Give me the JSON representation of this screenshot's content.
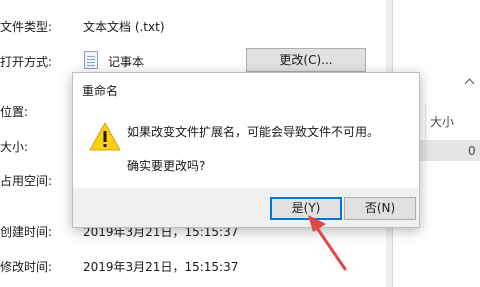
{
  "properties": {
    "type_label": "文件类型:",
    "type_value": "文本文档 (.txt)",
    "open_with_label": "打开方式:",
    "open_with_value": "记事本",
    "change_button": "更改(C)...",
    "location_label": "位置:",
    "size_label": "大小:",
    "size_on_disk_label": "占用空间:",
    "created_label": "创建时间:",
    "created_value": "2019年3月21日，15:15:37",
    "modified_label": "修改时间:",
    "modified_value": "2019年3月21日，15:15:37"
  },
  "background_panel": {
    "column_header": "大小",
    "row_value": "0"
  },
  "dialog": {
    "title": "重命名",
    "close": "✕",
    "message": "如果改变文件扩展名，可能会导致文件不可用。",
    "question": "确实要更改吗?",
    "yes_button": "是(Y)",
    "no_button": "否(N)",
    "icon": "warning-icon"
  },
  "colors": {
    "accent": "#0078d7",
    "warning": "#fcd116",
    "arrow": "#e04848"
  }
}
